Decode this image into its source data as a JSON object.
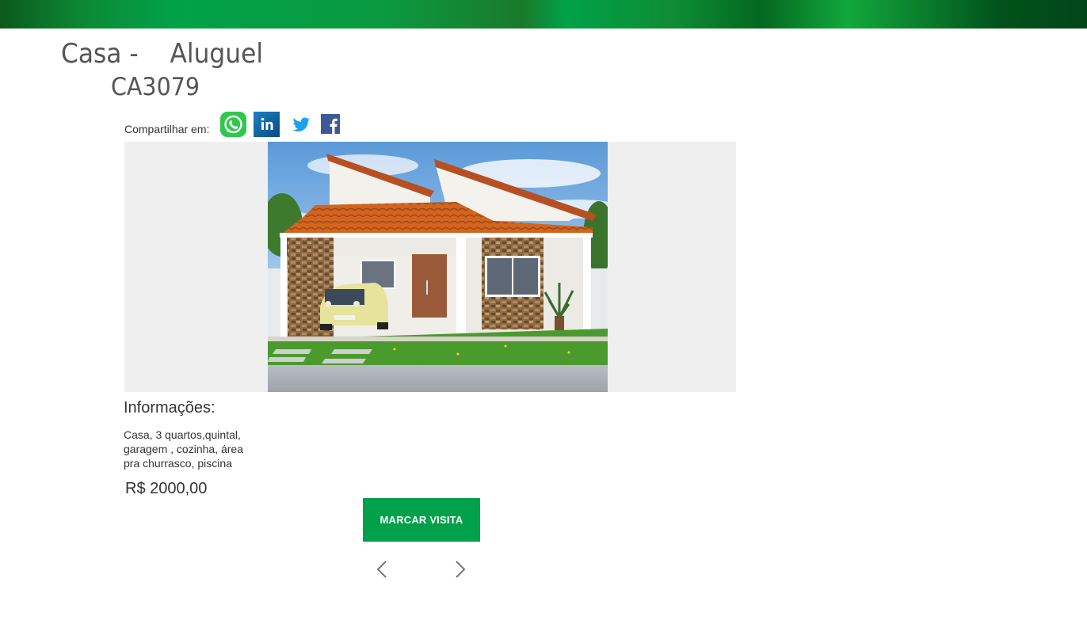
{
  "listing": {
    "title": "Casa -    Aluguel",
    "code": "CA3079",
    "photo_description": "house-photo"
  },
  "share": {
    "label": "Compartilhar em:",
    "icons": [
      "whatsapp-icon",
      "linkedin-icon",
      "twitter-icon",
      "facebook-icon"
    ]
  },
  "info": {
    "heading": "Informações:",
    "description": "Casa, 3 quartos,quintal, garagem , cozinha, área pra churrasco, piscina",
    "price": "R$ 2000,00"
  },
  "actions": {
    "visit_button": "MARCAR VISITA"
  },
  "colors": {
    "brand_green": "#00a14a",
    "banner_dark_green": "#0b5a1c",
    "text_gray": "#555555",
    "gallery_background": "#efefef"
  }
}
